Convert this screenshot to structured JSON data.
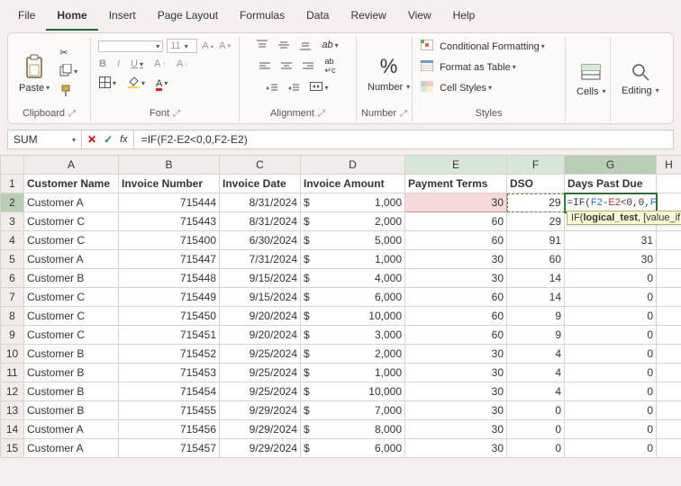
{
  "menu": [
    "File",
    "Home",
    "Insert",
    "Page Layout",
    "Formulas",
    "Data",
    "Review",
    "View",
    "Help"
  ],
  "active_menu": "Home",
  "ribbon": {
    "clipboard": {
      "paste": "Paste",
      "label": "Clipboard"
    },
    "font": {
      "name": "",
      "size": "11",
      "label": "Font"
    },
    "alignment": {
      "label": "Alignment"
    },
    "number": {
      "btn": "Number",
      "label": "Number"
    },
    "styles": {
      "cond": "Conditional Formatting",
      "table": "Format as Table",
      "cell": "Cell Styles",
      "label": "Styles"
    },
    "cells": {
      "btn": "Cells",
      "label": ""
    },
    "editing": {
      "btn": "Editing",
      "label": ""
    }
  },
  "formula_bar": {
    "namebox": "SUM",
    "formula": "=IF(F2-E2<0,0,F2-E2)"
  },
  "tooltip": "IF(logical_test, [value_if",
  "tooltip_bold": "logical_test",
  "columns": [
    "A",
    "B",
    "C",
    "D",
    "E",
    "F",
    "G",
    "H"
  ],
  "headers": [
    "Customer Name",
    "Invoice Number",
    "Invoice Date",
    "Invoice Amount",
    "Payment Terms",
    "DSO",
    "Days Past Due",
    ""
  ],
  "editing_formula": {
    "prefix": "=IF(",
    "r1": "F2",
    "mid1": "-",
    "r2": "E2",
    "mid2": "<0,0,",
    "r3": "F2",
    "mid3": "-",
    "r4": "E2",
    "suffix": ")"
  },
  "rows": [
    {
      "n": "2",
      "name": "Customer A",
      "inv": "715444",
      "date": "8/31/2024",
      "amt": "1,000",
      "terms": "30",
      "dso": "29",
      "dpd": ""
    },
    {
      "n": "3",
      "name": "Customer C",
      "inv": "715443",
      "date": "8/31/2024",
      "amt": "2,000",
      "terms": "60",
      "dso": "29",
      "dpd": ""
    },
    {
      "n": "4",
      "name": "Customer C",
      "inv": "715400",
      "date": "6/30/2024",
      "amt": "5,000",
      "terms": "60",
      "dso": "91",
      "dpd": "31"
    },
    {
      "n": "5",
      "name": "Customer A",
      "inv": "715447",
      "date": "7/31/2024",
      "amt": "1,000",
      "terms": "30",
      "dso": "60",
      "dpd": "30"
    },
    {
      "n": "6",
      "name": "Customer B",
      "inv": "715448",
      "date": "9/15/2024",
      "amt": "4,000",
      "terms": "30",
      "dso": "14",
      "dpd": "0"
    },
    {
      "n": "7",
      "name": "Customer C",
      "inv": "715449",
      "date": "9/15/2024",
      "amt": "6,000",
      "terms": "60",
      "dso": "14",
      "dpd": "0"
    },
    {
      "n": "8",
      "name": "Customer C",
      "inv": "715450",
      "date": "9/20/2024",
      "amt": "10,000",
      "terms": "60",
      "dso": "9",
      "dpd": "0"
    },
    {
      "n": "9",
      "name": "Customer C",
      "inv": "715451",
      "date": "9/20/2024",
      "amt": "3,000",
      "terms": "60",
      "dso": "9",
      "dpd": "0"
    },
    {
      "n": "10",
      "name": "Customer B",
      "inv": "715452",
      "date": "9/25/2024",
      "amt": "2,000",
      "terms": "30",
      "dso": "4",
      "dpd": "0"
    },
    {
      "n": "11",
      "name": "Customer B",
      "inv": "715453",
      "date": "9/25/2024",
      "amt": "1,000",
      "terms": "30",
      "dso": "4",
      "dpd": "0"
    },
    {
      "n": "12",
      "name": "Customer B",
      "inv": "715454",
      "date": "9/25/2024",
      "amt": "10,000",
      "terms": "30",
      "dso": "4",
      "dpd": "0"
    },
    {
      "n": "13",
      "name": "Customer B",
      "inv": "715455",
      "date": "9/29/2024",
      "amt": "7,000",
      "terms": "30",
      "dso": "0",
      "dpd": "0"
    },
    {
      "n": "14",
      "name": "Customer A",
      "inv": "715456",
      "date": "9/29/2024",
      "amt": "8,000",
      "terms": "30",
      "dso": "0",
      "dpd": "0"
    },
    {
      "n": "15",
      "name": "Customer A",
      "inv": "715457",
      "date": "9/29/2024",
      "amt": "6,000",
      "terms": "30",
      "dso": "0",
      "dpd": "0"
    }
  ]
}
